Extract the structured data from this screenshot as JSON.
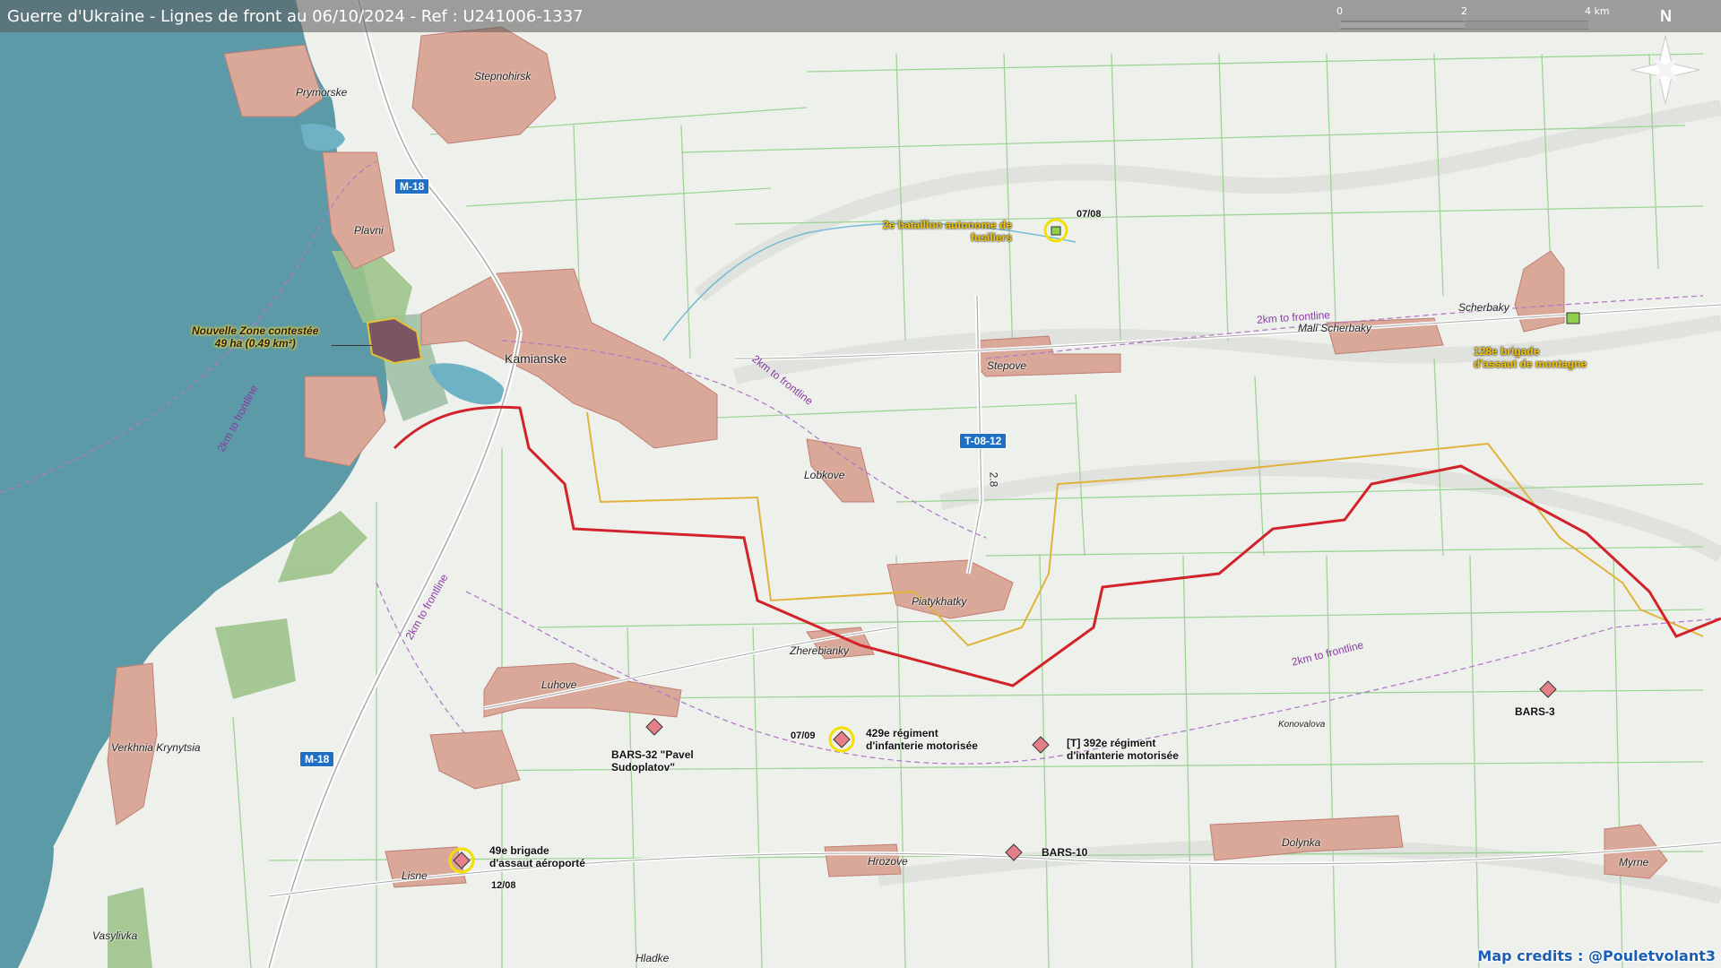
{
  "title": "Guerre d'Ukraine - Lignes de front au 06/10/2024 - Ref : U241006-1337",
  "scale": {
    "labels": [
      "0",
      "2",
      "4 km"
    ]
  },
  "north": "N",
  "credits": "Map credits : @Pouletvolant3",
  "roads": {
    "m18_top": "M-18",
    "m18_bottom": "M-18",
    "t0812": "T-08-12",
    "road_28": "2.8"
  },
  "places": {
    "prymorske": "Prymorske",
    "stepnohirsk": "Stepnohirsk",
    "plavni": "Plavni",
    "kamianske": "Kamianske",
    "stepove": "Stepove",
    "mali_scherbaky": "Mali Scherbaky",
    "scherbaky": "Scherbaky",
    "lobkove": "Lobkove",
    "piatykhatky": "Piatykhatky",
    "zherebianky": "Zherebianky",
    "luhove": "Luhove",
    "verkhnia_krynytsia": "Verkhnia Krynytsia",
    "lisne": "Lisne",
    "vasylivka": "Vasylivka",
    "hrozove": "Hrozove",
    "dolynka": "Dolynka",
    "myrne": "Myrne",
    "hladke": "Hladke",
    "konovalova": "Konovalova"
  },
  "frontline_buffers": [
    "2km to frontline",
    "2km to frontline",
    "2km to frontline",
    "2km to frontline",
    "2km to frontline"
  ],
  "contested_zone": {
    "line1": "Nouvelle Zone contestée",
    "line2": "49 ha (0.49 km²)"
  },
  "units": [
    {
      "line1": "2e bataillon autonome de",
      "line2": "fusiliers",
      "date": "07/08",
      "side": "ukraine",
      "echelon": "II"
    },
    {
      "line1": "128e brigade",
      "line2": "d'assaut de montagne",
      "side": "ukraine",
      "echelon": "X"
    },
    {
      "line1": "429e régiment",
      "line2": "d'infanterie motorisée",
      "date": "07/09",
      "side": "russia",
      "echelon": "III"
    },
    {
      "line1": "[T] 392e régiment",
      "line2": "d'infanterie motorisée",
      "side": "russia",
      "echelon": "III"
    },
    {
      "line1": "BARS-32 \"Pavel",
      "line2": "Sudoplatov\"",
      "side": "russia"
    },
    {
      "line1": "BARS-3",
      "side": "russia"
    },
    {
      "line1": "BARS-10",
      "side": "russia"
    },
    {
      "line1": "49e brigade",
      "line2": "d'assaut aéroporté",
      "date": "12/08",
      "side": "russia"
    }
  ],
  "colors": {
    "water": "#5b9aa6",
    "land": "#eef0ec",
    "urban": "#d9a898",
    "frontline_red": "#d2232a",
    "frontline_yellow": "#e0b43a",
    "fields": "#8fd18a",
    "ukraine_unit": "#8fd14f",
    "russia_unit": "#e5808a"
  }
}
